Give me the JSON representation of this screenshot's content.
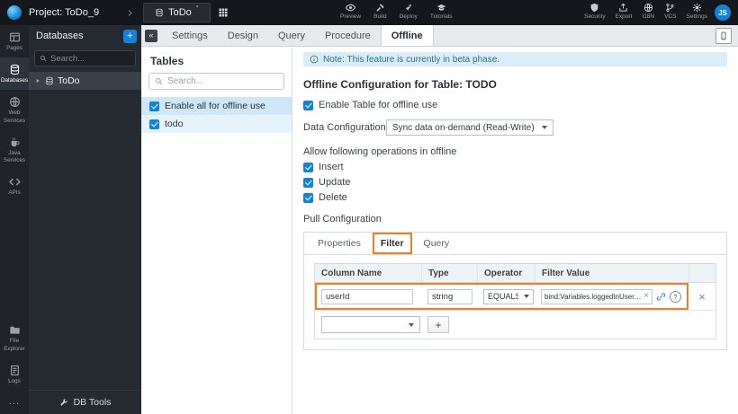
{
  "header": {
    "project_label": "Project: ToDo_9",
    "workspace_tab": "ToDo",
    "workspace_tab_mark": "°",
    "center_actions": [
      {
        "label": "Preview"
      },
      {
        "label": "Build"
      },
      {
        "label": "Deploy"
      },
      {
        "label": "Tutorials"
      }
    ],
    "right_actions": [
      {
        "label": "Security"
      },
      {
        "label": "Export"
      },
      {
        "label": "I18N"
      },
      {
        "label": "VCS"
      },
      {
        "label": "Settings"
      }
    ],
    "avatar_initials": "JS"
  },
  "activity_bar": {
    "items": [
      {
        "label": "Pages"
      },
      {
        "label": "Databases"
      },
      {
        "label": "Web Services"
      },
      {
        "label": "Java Services"
      },
      {
        "label": "APIs"
      }
    ],
    "bottom_items": [
      {
        "label": "File Explorer"
      },
      {
        "label": "Logs"
      }
    ],
    "more_glyph": "..."
  },
  "db_panel": {
    "title": "Databases",
    "add_label": "+",
    "collapse_glyph": "«",
    "search_placeholder": "Search...",
    "tree_item": "ToDo",
    "footer": "DB Tools"
  },
  "editor_tabs": {
    "items": [
      "Settings",
      "Design",
      "Query",
      "Procedure",
      "Offline"
    ],
    "active": "Offline"
  },
  "tables_panel": {
    "title": "Tables",
    "search_placeholder": "Search...",
    "rows": [
      {
        "label": "Enable all for offline use",
        "checked": true
      },
      {
        "label": "todo",
        "checked": true
      }
    ]
  },
  "offline": {
    "note": "Note: This feature is currently in beta phase.",
    "heading": "Offline Configuration for Table: TODO",
    "enable_table_label": "Enable Table for offline use",
    "data_configuration_label": "Data Configuration",
    "data_configuration_value": "Sync data on-demand (Read-Write)",
    "operations_label": "Allow following operations in offline",
    "operations": [
      {
        "label": "Insert",
        "checked": true
      },
      {
        "label": "Update",
        "checked": true
      },
      {
        "label": "Delete",
        "checked": true
      }
    ],
    "pull_configuration_label": "Pull Configuration",
    "pull_tabs": [
      "Properties",
      "Filter",
      "Query"
    ],
    "pull_active_tab": "Filter",
    "filter_table": {
      "headers": [
        "Column Name",
        "Type",
        "Operator",
        "Filter Value"
      ],
      "row": {
        "column_name": "userId",
        "type": "string",
        "operator": "EQUALS",
        "filter_value": "bind:Variables.loggedInUser.data"
      },
      "clear_glyph": "×",
      "help_glyph": "?",
      "delete_glyph": "×",
      "add_label": "+"
    }
  },
  "colors": {
    "accent": "#1283d8",
    "annotation": "#ee7d28",
    "info_banner_bg": "#d9edf8",
    "topbar_bg": "#14171c"
  }
}
